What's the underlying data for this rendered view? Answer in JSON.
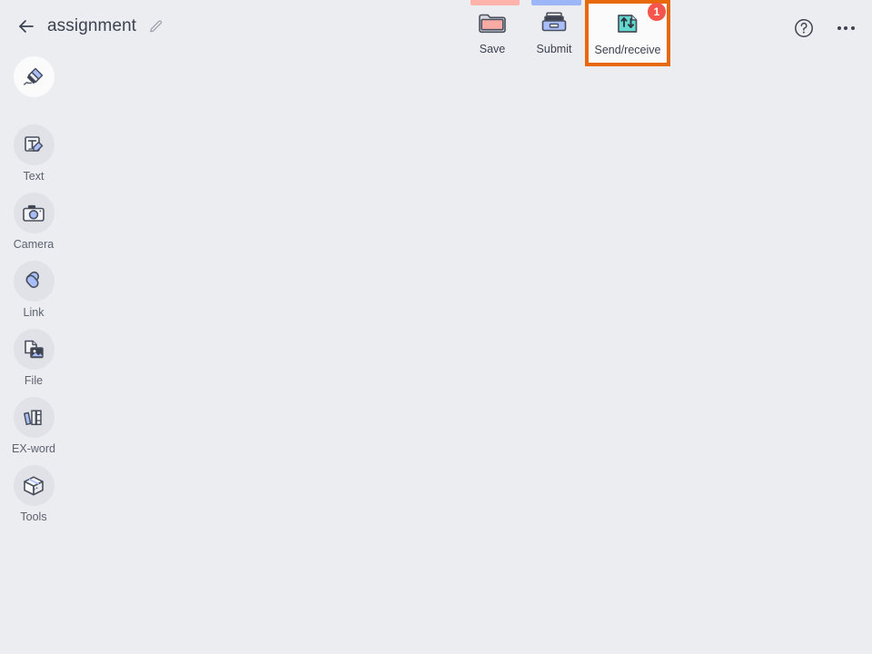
{
  "window": {
    "background_color": "#ecedf1"
  },
  "header": {
    "back_icon": "back-arrow-icon",
    "title": "assignment",
    "edit_icon": "pencil-edit-icon",
    "tabs": [
      {
        "name": "tab-strip-pink",
        "color": "#ffb3aa"
      },
      {
        "name": "tab-strip-blue",
        "color": "#9db6f7"
      }
    ],
    "toolbar": [
      {
        "key": "save",
        "label": "Save",
        "icon": "folder-icon",
        "icon_color": "#f7aba4",
        "highlighted": false,
        "badge": null
      },
      {
        "key": "submit",
        "label": "Submit",
        "icon": "printer-icon",
        "icon_color": "#a8bffb",
        "highlighted": false,
        "badge": null
      },
      {
        "key": "send-receive",
        "label": "Send/receive",
        "icon": "send-receive-tray-icon",
        "icon_color": "#62d8cf",
        "highlighted": true,
        "highlight_color": "#e8690b",
        "badge": "1",
        "badge_color": "#f4554c"
      }
    ],
    "help_icon": "help-circle-icon",
    "more_icon": "more-options-icon"
  },
  "sidebar": {
    "items": [
      {
        "key": "pen",
        "label": "",
        "icon": "highlighter-pen-icon",
        "active": true
      },
      {
        "key": "text",
        "label": "Text",
        "icon": "text-edit-icon",
        "active": false
      },
      {
        "key": "camera",
        "label": "Camera",
        "icon": "camera-icon",
        "active": false
      },
      {
        "key": "link",
        "label": "Link",
        "icon": "link-chain-icon",
        "active": false
      },
      {
        "key": "file",
        "label": "File",
        "icon": "file-image-icon",
        "active": false
      },
      {
        "key": "exword",
        "label": "EX-word",
        "icon": "books-icon",
        "active": false
      },
      {
        "key": "tools",
        "label": "Tools",
        "icon": "toolbox-cube-icon",
        "active": false
      }
    ]
  },
  "canvas": {
    "content": ""
  }
}
